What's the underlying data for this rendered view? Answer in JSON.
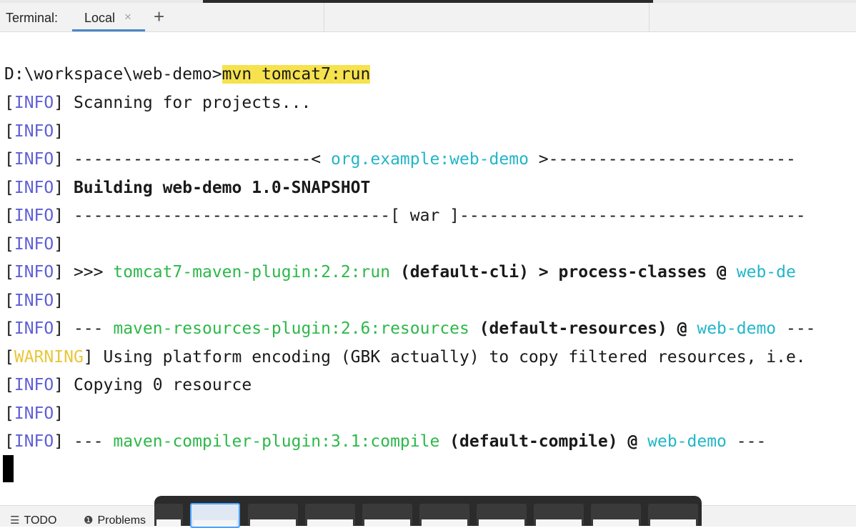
{
  "tab_bar": {
    "title": "Terminal:",
    "active_tab": "Local",
    "close_glyph": "×",
    "add_glyph": "+"
  },
  "terminal": {
    "prompt": "D:\\workspace\\web-demo>",
    "command": "mvn tomcat7:run",
    "lines": [
      {
        "level": "INFO",
        "segments": [
          {
            "text": " Scanning for projects...",
            "style": "plain"
          }
        ]
      },
      {
        "level": "INFO",
        "segments": []
      },
      {
        "level": "INFO",
        "segments": [
          {
            "text": " ------------------------< ",
            "style": "plain"
          },
          {
            "text": "org.example:web-demo",
            "style": "cyan"
          },
          {
            "text": " >-------------------------",
            "style": "plain"
          }
        ]
      },
      {
        "level": "INFO",
        "segments": [
          {
            "text": " Building web-demo 1.0-SNAPSHOT",
            "style": "bold"
          }
        ]
      },
      {
        "level": "INFO",
        "segments": [
          {
            "text": " --------------------------------[ war ]-----------------------------------",
            "style": "plain"
          }
        ]
      },
      {
        "level": "INFO",
        "segments": []
      },
      {
        "level": "INFO",
        "segments": [
          {
            "text": " >>> ",
            "style": "plain"
          },
          {
            "text": "tomcat7-maven-plugin:2.2:run",
            "style": "green"
          },
          {
            "text": " (default-cli) > process-classes @ ",
            "style": "bold"
          },
          {
            "text": "web-de",
            "style": "cyan"
          }
        ]
      },
      {
        "level": "INFO",
        "segments": []
      },
      {
        "level": "INFO",
        "segments": [
          {
            "text": " --- ",
            "style": "plain"
          },
          {
            "text": "maven-resources-plugin:2.6:resources",
            "style": "green"
          },
          {
            "text": " (default-resources) @ ",
            "style": "bold"
          },
          {
            "text": "web-demo",
            "style": "cyan"
          },
          {
            "text": " ---",
            "style": "plain"
          }
        ]
      },
      {
        "level": "WARNING",
        "segments": [
          {
            "text": " Using platform encoding (GBK actually) to copy filtered resources, i.e.",
            "style": "plain"
          }
        ]
      },
      {
        "level": "INFO",
        "segments": [
          {
            "text": " Copying 0 resource",
            "style": "plain"
          }
        ]
      },
      {
        "level": "INFO",
        "segments": []
      },
      {
        "level": "INFO",
        "segments": [
          {
            "text": " --- ",
            "style": "plain"
          },
          {
            "text": "maven-compiler-plugin:3.1:compile",
            "style": "green"
          },
          {
            "text": " (default-compile) @ ",
            "style": "bold"
          },
          {
            "text": "web-demo",
            "style": "cyan"
          },
          {
            "text": " ---",
            "style": "plain"
          }
        ]
      }
    ]
  },
  "bottom_bar": {
    "todo_label": "TODO",
    "problems_label": "Problems",
    "todo_icon": "list-icon",
    "problems_icon": "warning-circle-icon"
  },
  "colors": {
    "info_tag": "#5f5fd7",
    "warning_tag": "#e8c63c",
    "plugin_green": "#2db84a",
    "artifact_cyan": "#22b6c8",
    "command_highlight": "#f6e24d",
    "active_tab_underline": "#4a86c8"
  }
}
